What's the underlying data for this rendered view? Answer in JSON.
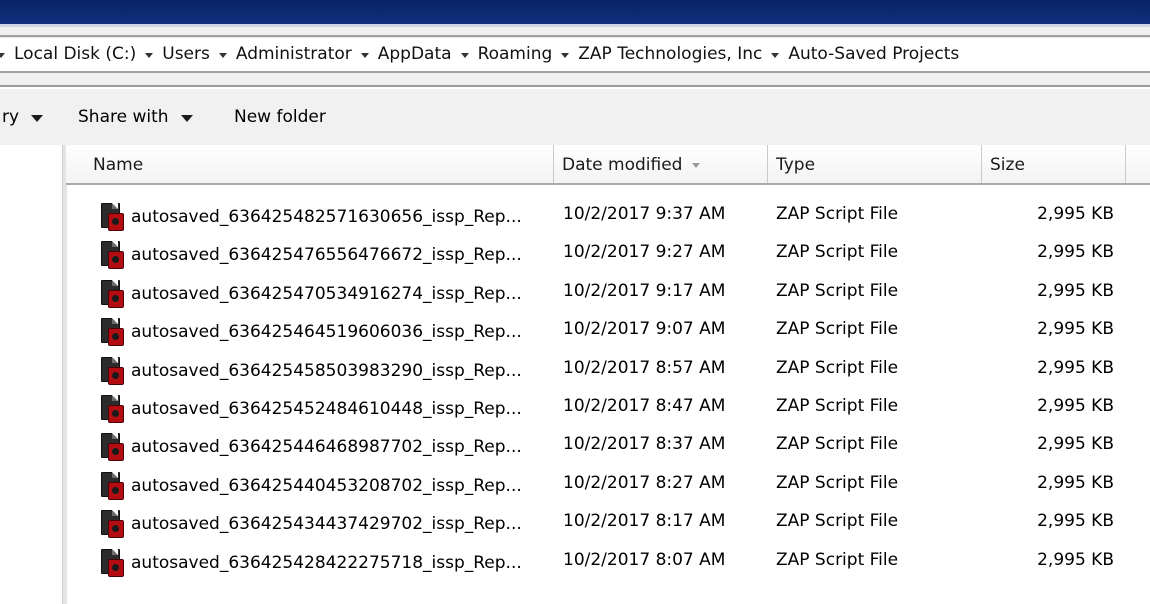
{
  "breadcrumbs": [
    "Local Disk (C:)",
    "Users",
    "Administrator",
    "AppData",
    "Roaming",
    "ZAP Technologies, Inc",
    "Auto-Saved Projects"
  ],
  "toolbar": {
    "library_label": "ry",
    "share_label": "Share with",
    "new_folder_label": "New folder"
  },
  "columns": {
    "name": "Name",
    "date": "Date modified",
    "type": "Type",
    "size": "Size"
  },
  "files": [
    {
      "name": "autosaved_636425482571630656_issp_Rep...",
      "date": "10/2/2017 9:37 AM",
      "type": "ZAP Script File",
      "size": "2,995 KB"
    },
    {
      "name": "autosaved_636425476556476672_issp_Rep...",
      "date": "10/2/2017 9:27 AM",
      "type": "ZAP Script File",
      "size": "2,995 KB"
    },
    {
      "name": "autosaved_636425470534916274_issp_Rep...",
      "date": "10/2/2017 9:17 AM",
      "type": "ZAP Script File",
      "size": "2,995 KB"
    },
    {
      "name": "autosaved_636425464519606036_issp_Rep...",
      "date": "10/2/2017 9:07 AM",
      "type": "ZAP Script File",
      "size": "2,995 KB"
    },
    {
      "name": "autosaved_636425458503983290_issp_Rep...",
      "date": "10/2/2017 8:57 AM",
      "type": "ZAP Script File",
      "size": "2,995 KB"
    },
    {
      "name": "autosaved_636425452484610448_issp_Rep...",
      "date": "10/2/2017 8:47 AM",
      "type": "ZAP Script File",
      "size": "2,995 KB"
    },
    {
      "name": "autosaved_636425446468987702_issp_Rep...",
      "date": "10/2/2017 8:37 AM",
      "type": "ZAP Script File",
      "size": "2,995 KB"
    },
    {
      "name": "autosaved_636425440453208702_issp_Rep...",
      "date": "10/2/2017 8:27 AM",
      "type": "ZAP Script File",
      "size": "2,995 KB"
    },
    {
      "name": "autosaved_636425434437429702_issp_Rep...",
      "date": "10/2/2017 8:17 AM",
      "type": "ZAP Script File",
      "size": "2,995 KB"
    },
    {
      "name": "autosaved_636425428422275718_issp_Rep...",
      "date": "10/2/2017 8:07 AM",
      "type": "ZAP Script File",
      "size": "2,995 KB"
    }
  ]
}
